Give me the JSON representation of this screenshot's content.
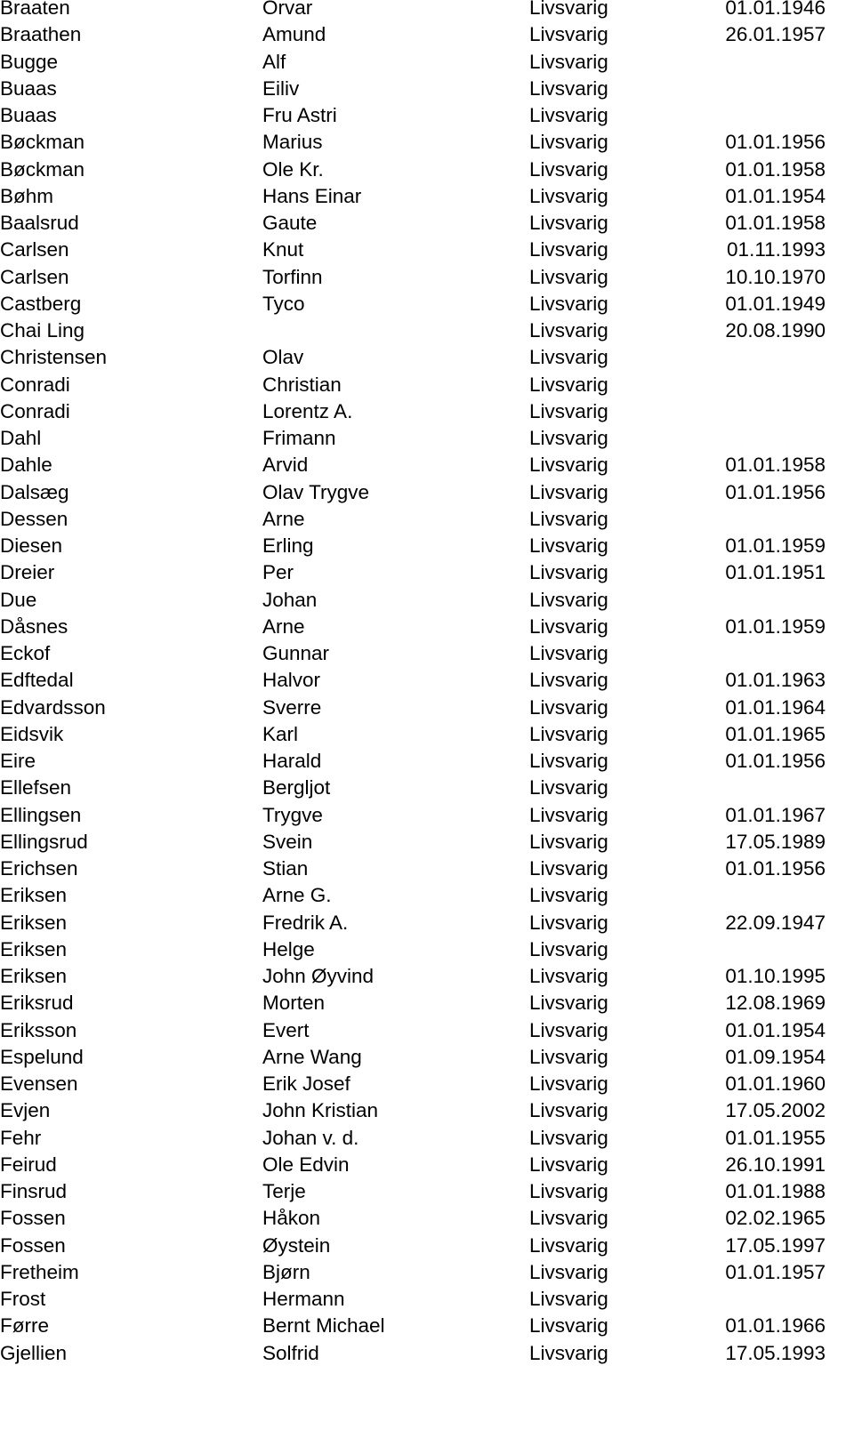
{
  "table": {
    "rows": [
      [
        "Braaten",
        "Orvar",
        "Livsvarig",
        "01.01.1946"
      ],
      [
        "Braathen",
        "Amund",
        "Livsvarig",
        "26.01.1957"
      ],
      [
        "Bugge",
        "Alf",
        "Livsvarig",
        ""
      ],
      [
        "Buaas",
        "Eiliv",
        "Livsvarig",
        ""
      ],
      [
        "Buaas",
        "Fru Astri",
        "Livsvarig",
        ""
      ],
      [
        "Bøckman",
        "Marius",
        "Livsvarig",
        "01.01.1956"
      ],
      [
        "Bøckman",
        "Ole Kr.",
        "Livsvarig",
        "01.01.1958"
      ],
      [
        "Bøhm",
        "Hans Einar",
        "Livsvarig",
        "01.01.1954"
      ],
      [
        "Baalsrud",
        "Gaute",
        "Livsvarig",
        "01.01.1958"
      ],
      [
        "Carlsen",
        "Knut",
        "Livsvarig",
        "01.11.1993"
      ],
      [
        "Carlsen",
        "Torfinn",
        "Livsvarig",
        "10.10.1970"
      ],
      [
        "Castberg",
        "Tyco",
        "Livsvarig",
        "01.01.1949"
      ],
      [
        "Chai Ling",
        "",
        "Livsvarig",
        "20.08.1990"
      ],
      [
        "Christensen",
        "Olav",
        "Livsvarig",
        ""
      ],
      [
        "Conradi",
        "Christian",
        "Livsvarig",
        ""
      ],
      [
        "Conradi",
        "Lorentz A.",
        "Livsvarig",
        ""
      ],
      [
        "Dahl",
        "Frimann",
        "Livsvarig",
        ""
      ],
      [
        "Dahle",
        "Arvid",
        "Livsvarig",
        "01.01.1958"
      ],
      [
        "Dalsæg",
        "Olav Trygve",
        "Livsvarig",
        "01.01.1956"
      ],
      [
        "Dessen",
        "Arne",
        "Livsvarig",
        ""
      ],
      [
        "Diesen",
        "Erling",
        "Livsvarig",
        "01.01.1959"
      ],
      [
        "Dreier",
        "Per",
        "Livsvarig",
        "01.01.1951"
      ],
      [
        "Due",
        "Johan",
        "Livsvarig",
        ""
      ],
      [
        "Dåsnes",
        "Arne",
        "Livsvarig",
        "01.01.1959"
      ],
      [
        "Eckof",
        "Gunnar",
        "Livsvarig",
        ""
      ],
      [
        "Edftedal",
        "Halvor",
        "Livsvarig",
        "01.01.1963"
      ],
      [
        "Edvardsson",
        "Sverre",
        "Livsvarig",
        "01.01.1964"
      ],
      [
        "Eidsvik",
        "Karl",
        "Livsvarig",
        "01.01.1965"
      ],
      [
        "Eire",
        "Harald",
        "Livsvarig",
        "01.01.1956"
      ],
      [
        "Ellefsen",
        "Bergljot",
        "Livsvarig",
        ""
      ],
      [
        "Ellingsen",
        "Trygve",
        "Livsvarig",
        "01.01.1967"
      ],
      [
        "Ellingsrud",
        "Svein",
        "Livsvarig",
        "17.05.1989"
      ],
      [
        "Erichsen",
        "Stian",
        "Livsvarig",
        "01.01.1956"
      ],
      [
        "Eriksen",
        "Arne G.",
        "Livsvarig",
        ""
      ],
      [
        "Eriksen",
        "Fredrik A.",
        "Livsvarig",
        "22.09.1947"
      ],
      [
        "Eriksen",
        "Helge",
        "Livsvarig",
        ""
      ],
      [
        "Eriksen",
        "John Øyvind",
        "Livsvarig",
        "01.10.1995"
      ],
      [
        "Eriksrud",
        "Morten",
        "Livsvarig",
        "12.08.1969"
      ],
      [
        "Eriksson",
        "Evert",
        "Livsvarig",
        "01.01.1954"
      ],
      [
        "Espelund",
        "Arne Wang",
        "Livsvarig",
        "01.09.1954"
      ],
      [
        "Evensen",
        "Erik Josef",
        "Livsvarig",
        "01.01.1960"
      ],
      [
        "Evjen",
        "John Kristian",
        "Livsvarig",
        "17.05.2002"
      ],
      [
        "Fehr",
        "Johan v. d.",
        "Livsvarig",
        "01.01.1955"
      ],
      [
        "Feirud",
        "Ole Edvin",
        "Livsvarig",
        "26.10.1991"
      ],
      [
        "Finsrud",
        "Terje",
        "Livsvarig",
        "01.01.1988"
      ],
      [
        "Fossen",
        "Håkon",
        "Livsvarig",
        "02.02.1965"
      ],
      [
        "Fossen",
        "Øystein",
        "Livsvarig",
        "17.05.1997"
      ],
      [
        "Fretheim",
        "Bjørn",
        "Livsvarig",
        "01.01.1957"
      ],
      [
        "Frost",
        "Hermann",
        "Livsvarig",
        ""
      ],
      [
        "Førre",
        "Bernt Michael",
        "Livsvarig",
        "01.01.1966"
      ],
      [
        "Gjellien",
        "Solfrid",
        "Livsvarig",
        "17.05.1993"
      ]
    ]
  }
}
